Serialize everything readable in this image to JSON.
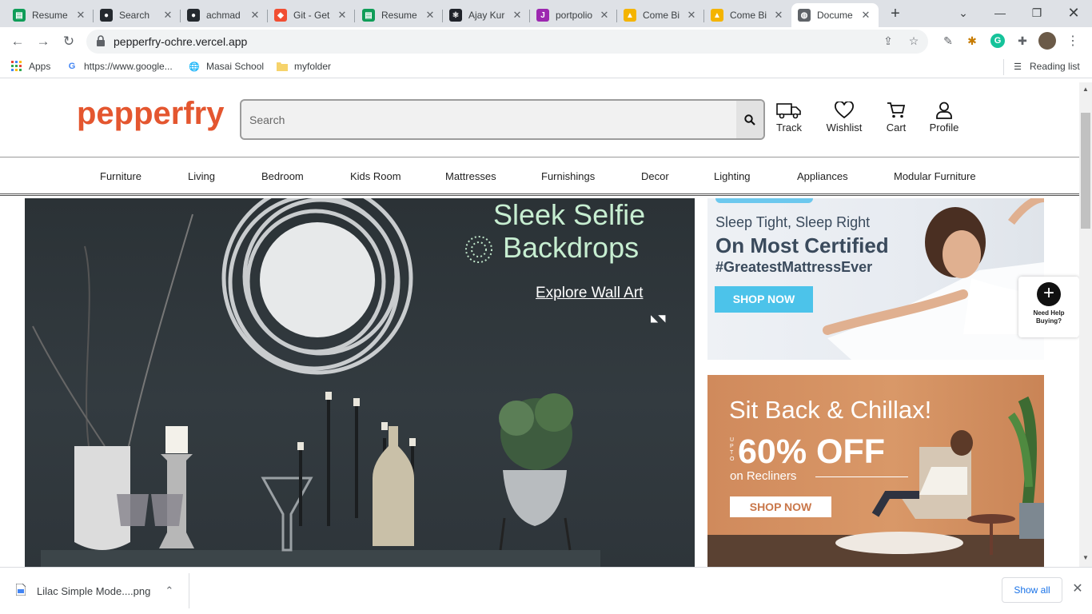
{
  "browser": {
    "tabs": [
      {
        "title": "Resume",
        "icon": "sheets-icon",
        "color": "#0f9d58"
      },
      {
        "title": "Search",
        "icon": "github-icon",
        "color": "#24292e"
      },
      {
        "title": "achmad",
        "icon": "github-icon",
        "color": "#24292e"
      },
      {
        "title": "Git - Get",
        "icon": "git-icon",
        "color": "#f14e32"
      },
      {
        "title": "Resume",
        "icon": "sheets-icon",
        "color": "#0f9d58"
      },
      {
        "title": "Ajay Kur",
        "icon": "react-icon",
        "color": "#20232a"
      },
      {
        "title": "portpolio",
        "icon": "j-icon",
        "color": "#9c27b0"
      },
      {
        "title": "Come Bi",
        "icon": "drive-icon",
        "color": "#f4b400"
      },
      {
        "title": "Come Bi",
        "icon": "drive-icon",
        "color": "#f4b400"
      },
      {
        "title": "Docume",
        "icon": "globe-icon",
        "color": "#5f6368"
      }
    ],
    "url": "pepperfry-ochre.vercel.app",
    "bookmarks": [
      {
        "label": "Apps",
        "icon": "apps-grid-icon"
      },
      {
        "label": "https://www.google...",
        "icon": "google-icon"
      },
      {
        "label": "Masai School",
        "icon": "globe-icon"
      },
      {
        "label": "myfolder",
        "icon": "folder-icon"
      }
    ],
    "reading_list": "Reading list"
  },
  "header": {
    "logo": "pepperfry",
    "search_placeholder": "Search",
    "icons": [
      {
        "label": "Track",
        "icon": "truck-icon"
      },
      {
        "label": "Wishlist",
        "icon": "heart-icon"
      },
      {
        "label": "Cart",
        "icon": "cart-icon"
      },
      {
        "label": "Profile",
        "icon": "user-icon"
      }
    ]
  },
  "categories": [
    "Furniture",
    "Living",
    "Bedroom",
    "Kids Room",
    "Mattresses",
    "Furnishings",
    "Decor",
    "Lighting",
    "Appliances",
    "Modular Furniture"
  ],
  "main_banner": {
    "headline_1": "Sleek Selfie",
    "headline_2": "Backdrops",
    "cta": "Explore Wall Art"
  },
  "side_banner_1": {
    "line1": "Sleep Tight, Sleep Right",
    "line2": "On Most Certified",
    "line3": "#GreatestMattressEver",
    "cta": "SHOP NOW"
  },
  "side_banner_2": {
    "line1": "Sit Back & Chillax!",
    "upto": "UPTO",
    "discount": "60% OFF",
    "line3": "on Recliners",
    "cta": "SHOP NOW"
  },
  "help_widget": {
    "line1": "Need Help",
    "line2": "Buying?"
  },
  "download_bar": {
    "file": "Lilac Simple Mode....png",
    "show_all": "Show all"
  },
  "colors": {
    "brand": "#e4562f",
    "mattress_cta": "#4cc3ea",
    "sky": "#6cc8ee"
  }
}
